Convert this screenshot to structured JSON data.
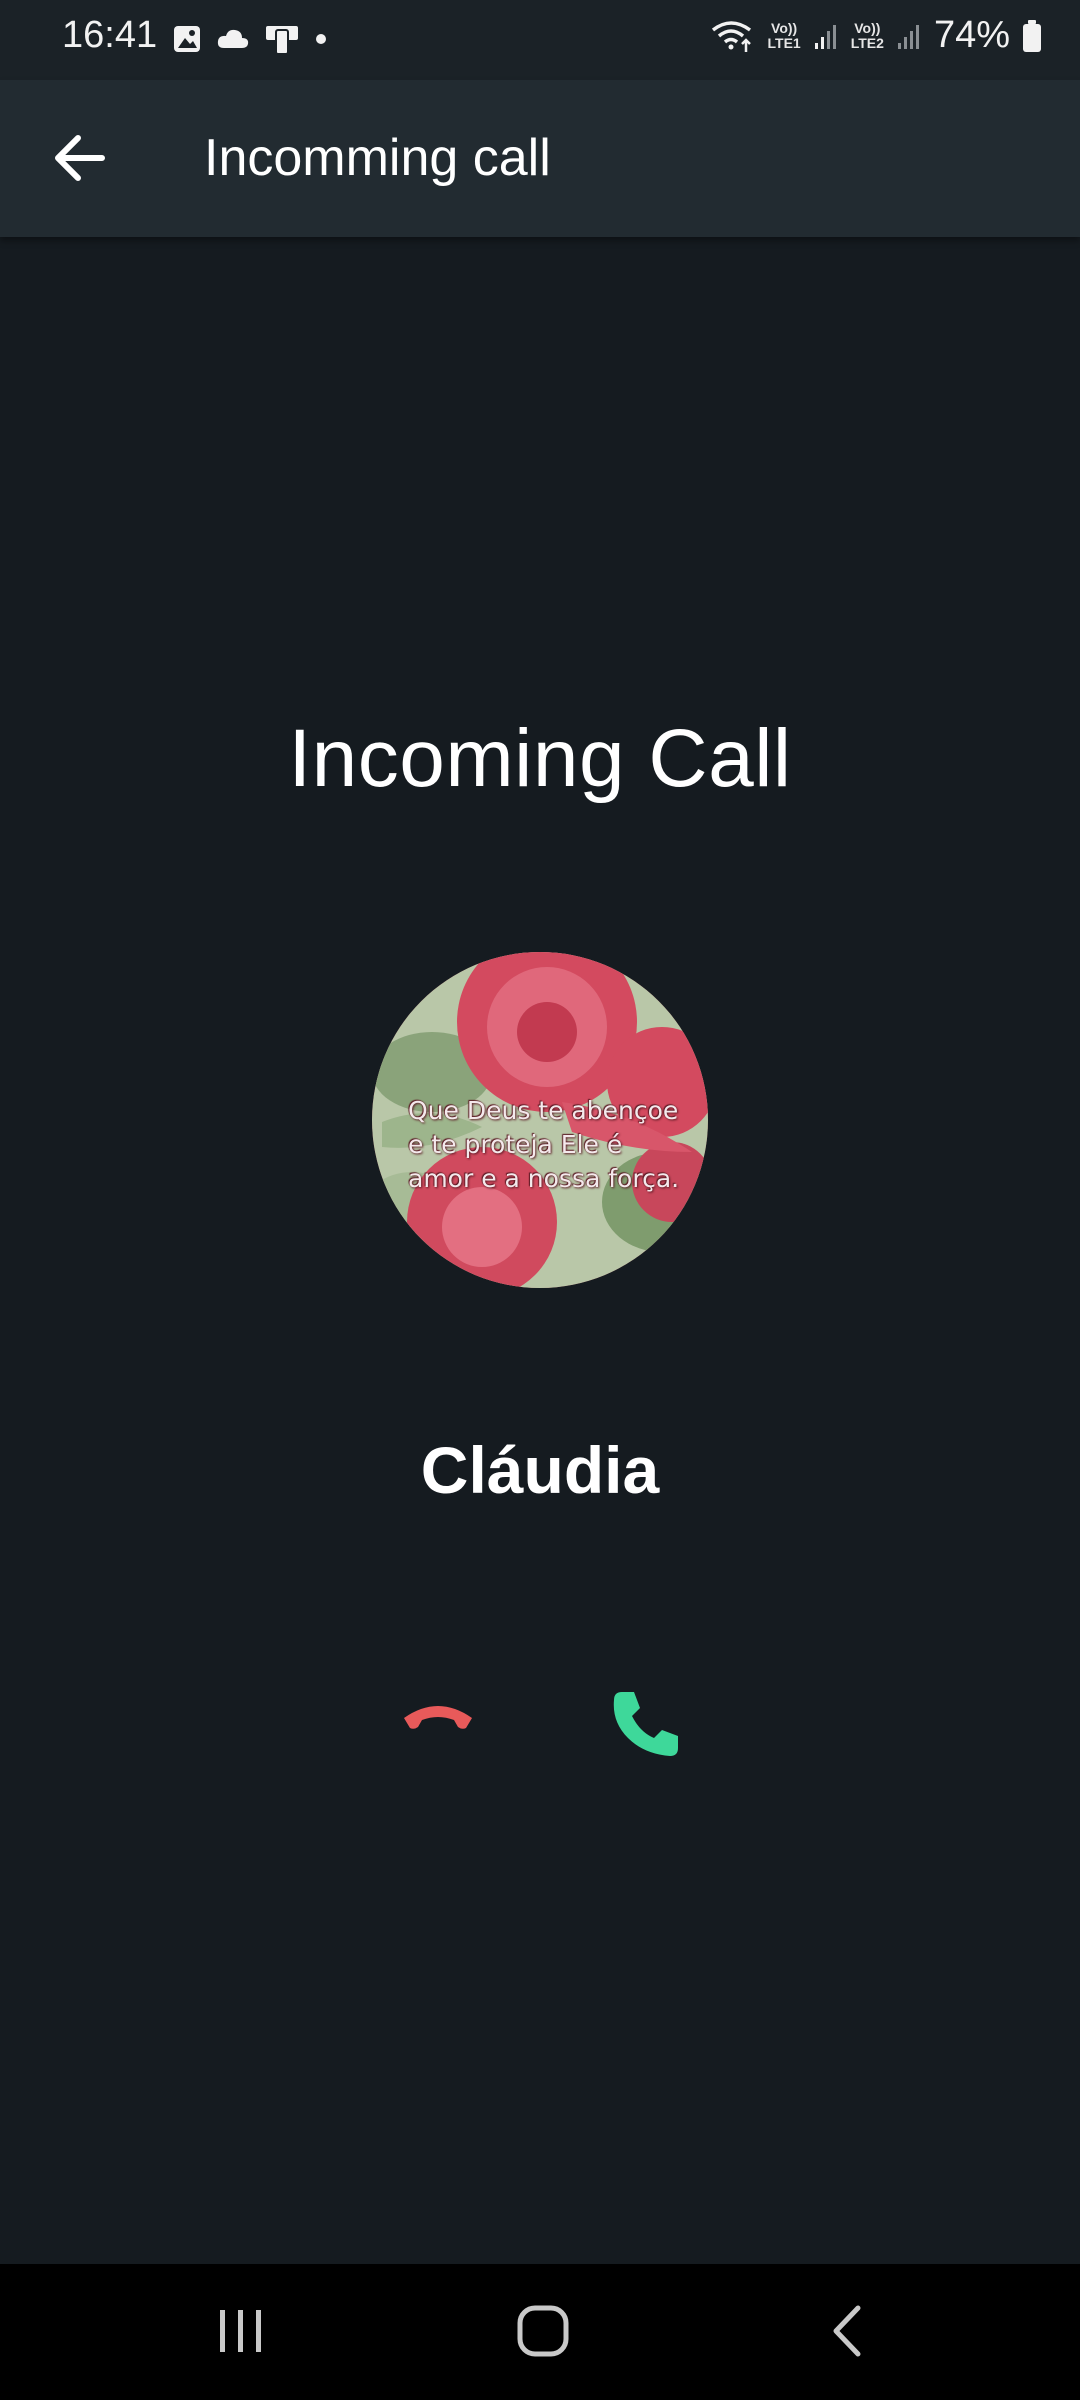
{
  "status_bar": {
    "time": "16:41",
    "battery_percent": "74%",
    "sim1_top": "Vo))",
    "sim1_bottom": "LTE1",
    "sim2_top": "Vo))",
    "sim2_bottom": "LTE2",
    "icons": [
      "gallery-icon",
      "cloud-icon",
      "device-icon",
      "dot-icon",
      "wifi-icon",
      "signal-icon",
      "battery-icon"
    ]
  },
  "app_bar": {
    "title": "Incomming call",
    "back_icon": "arrow-left-icon"
  },
  "call": {
    "heading": "Incoming Call",
    "caller_name": "Cláudia",
    "avatar_text": "Que Deus te abençoe e te proteja Ele é amor e a nossa força.",
    "decline_icon": "call-end-icon",
    "accept_icon": "phone-icon",
    "decline_color": "#e85a5a",
    "accept_color": "#3ed89a"
  },
  "nav_bar": {
    "icons": [
      "recents-icon",
      "home-icon",
      "back-icon"
    ]
  }
}
